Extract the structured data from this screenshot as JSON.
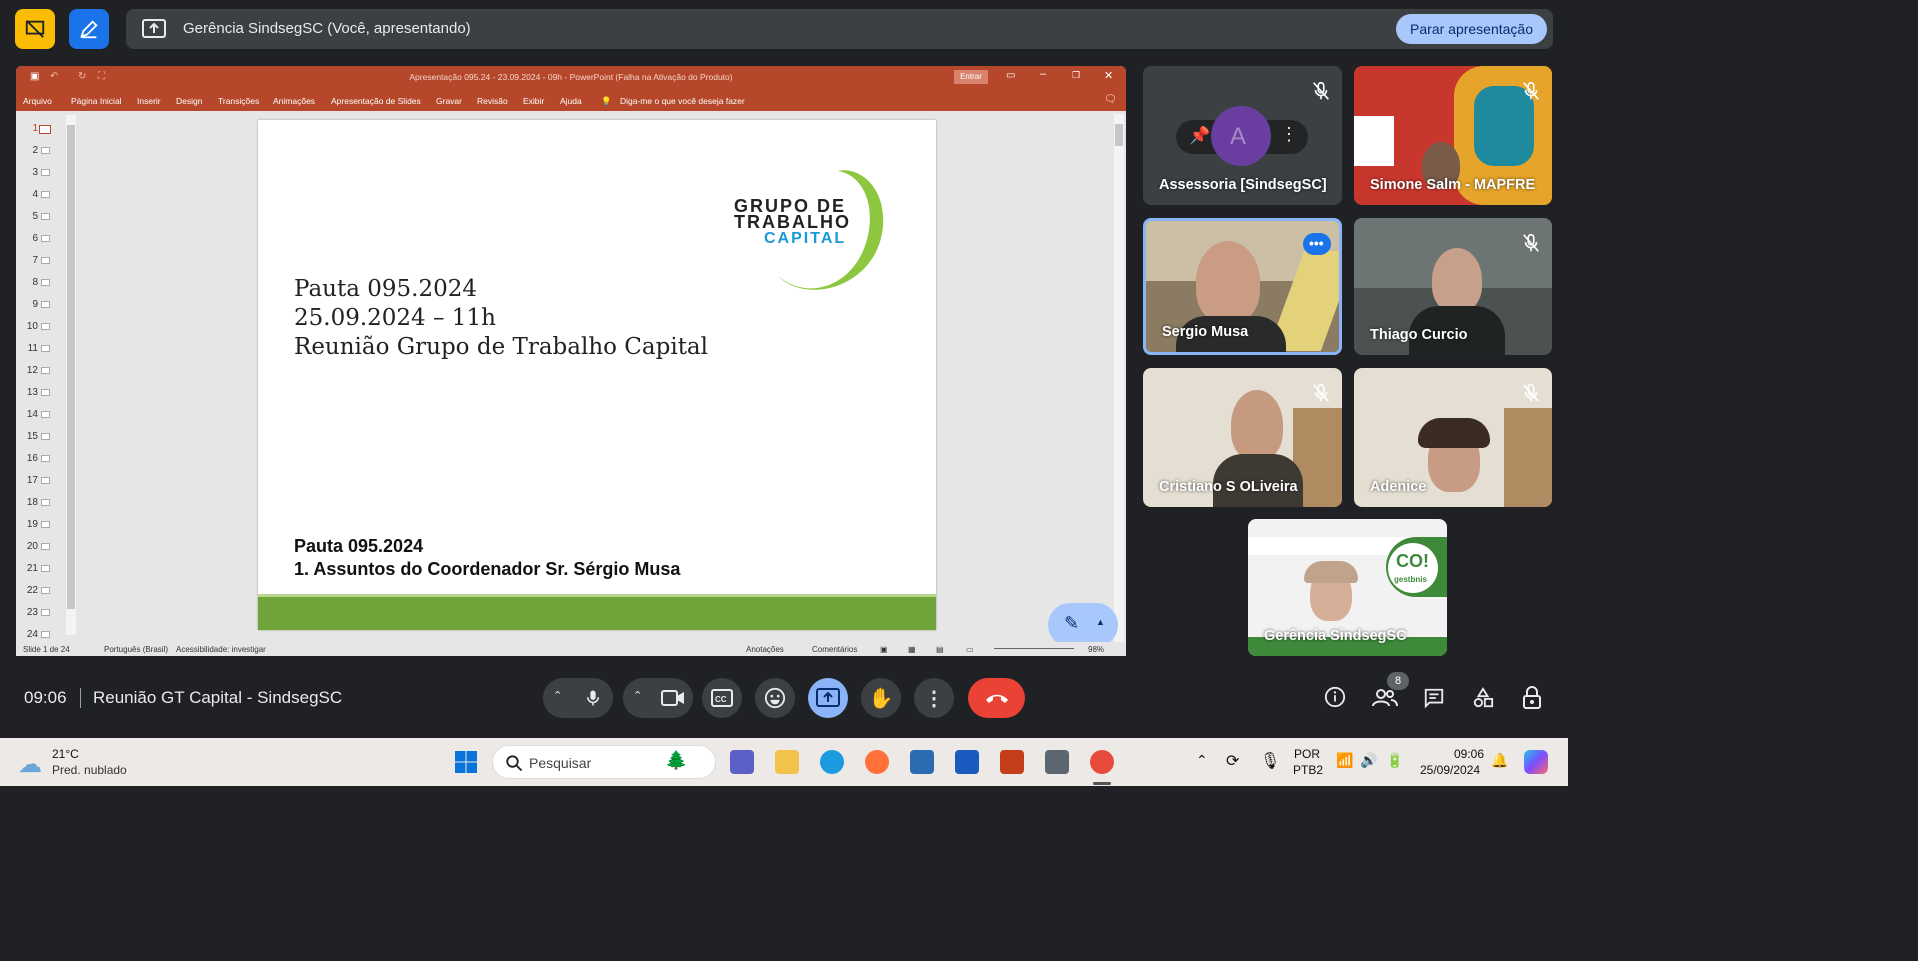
{
  "top_bar": {
    "presenting_banner_title": "Gerência SindsegSC (Você, apresentando)",
    "stop_presenting_label": "Parar apresentação"
  },
  "ppt": {
    "window_title": "Apresentação 095.24 - 23.09.2024 - 09h  -  PowerPoint (Falha na Ativação do Produto)",
    "signin_label": "Entrar",
    "menu": [
      "Arquivo",
      "Página Inicial",
      "Inserir",
      "Design",
      "Transições",
      "Animações",
      "Apresentação de Slides",
      "Gravar",
      "Revisão",
      "Exibir",
      "Ajuda"
    ],
    "tell_me": "Diga-me o que você deseja fazer",
    "slide_numbers": [
      "1",
      "2",
      "3",
      "4",
      "5",
      "6",
      "7",
      "8",
      "9",
      "10",
      "11",
      "12",
      "13",
      "14",
      "15",
      "16",
      "17",
      "18",
      "19",
      "20",
      "21",
      "22",
      "23",
      "24"
    ],
    "slide": {
      "logo_line1": "GRUPO DE",
      "logo_line2": "TRABALHO",
      "logo_line3": "CAPITAL",
      "line1": "Pauta 095.2024",
      "line2": "25.09.2024 – 11h",
      "line3": "Reunião Grupo de Trabalho Capital",
      "bold1": "Pauta 095.2024",
      "bold2": "1. Assuntos do Coordenador Sr. Sérgio Musa"
    },
    "status": {
      "slide_count": "Slide 1 de 24",
      "language": "Português (Brasil)",
      "accessibility": "Acessibilidade: investigar",
      "notes": "Anotações",
      "comments": "Comentários",
      "zoom": "98%"
    }
  },
  "participants": [
    {
      "name": "Assessoria [SindsegSC]",
      "muted": true
    },
    {
      "name": "Simone Salm - MAPFRE",
      "muted": true
    },
    {
      "name": "Sergio Musa",
      "muted": false
    },
    {
      "name": "Thiago Curcio",
      "muted": true
    },
    {
      "name": "Cristiano S OLiveira",
      "muted": true
    },
    {
      "name": "Adenice",
      "muted": true
    },
    {
      "name": "Gerência SindsegSC",
      "muted": false
    }
  ],
  "self_tile_text": {
    "brand": "gestbnis"
  },
  "bottom_bar": {
    "time": "09:06",
    "meeting_name": "Reunião GT Capital - SindsegSC",
    "participant_count": "8"
  },
  "taskbar": {
    "weather_temp": "21°C",
    "weather_desc": "Pred. nublado",
    "search_placeholder": "Pesquisar",
    "lang_line1": "POR",
    "lang_line2": "PTB2",
    "clock_time": "09:06",
    "clock_date": "25/09/2024"
  },
  "colors": {
    "ppt_accent": "#b7472a",
    "meet_bg": "#202124",
    "stop_btn": "#a8c7fa",
    "end_call": "#ea4335",
    "present_active": "#8ab4f8",
    "slide_green": "#6ea43a",
    "logo_green": "#8dc63f",
    "logo_blue": "#1a9ad6"
  }
}
